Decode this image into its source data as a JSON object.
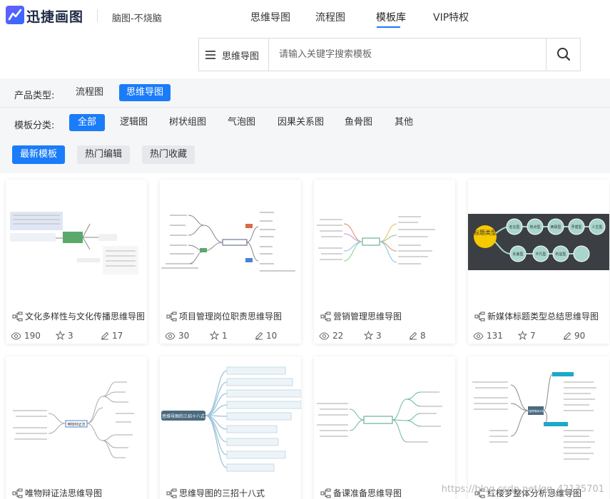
{
  "header": {
    "brand": "迅捷画图",
    "slogan": "脑图-不烧脑",
    "nav": [
      "思维导图",
      "流程图",
      "模板库",
      "VIP特权"
    ],
    "active_nav": "模板库"
  },
  "search": {
    "type_label": "思维导图",
    "placeholder": "请输入关键字搜索模板"
  },
  "filters": {
    "product_label": "产品类型:",
    "product_options": [
      "流程图",
      "思维导图"
    ],
    "product_selected": "思维导图",
    "category_label": "模板分类:",
    "category_options": [
      "全部",
      "逻辑图",
      "树状组图",
      "气泡图",
      "因果关系图",
      "鱼骨图",
      "其他"
    ],
    "category_selected": "全部",
    "sort_options": [
      "最新模板",
      "热门编辑",
      "热门收藏"
    ],
    "sort_selected": "最新模板"
  },
  "templates": [
    {
      "title": "文化多样性与文化传播思维导图",
      "views": "190",
      "stars": "3",
      "edits": "17"
    },
    {
      "title": "项目管理岗位职责思维导图",
      "views": "30",
      "stars": "1",
      "edits": "10"
    },
    {
      "title": "营销管理思维导图",
      "views": "22",
      "stars": "3",
      "edits": "8"
    },
    {
      "title": "新媒体标题类型总结思维导图",
      "views": "131",
      "stars": "7",
      "edits": "90"
    },
    {
      "title": "唯物辩证法思维导图",
      "views": "",
      "stars": "",
      "edits": ""
    },
    {
      "title": "思维导图的三招十八式",
      "views": "",
      "stars": "",
      "edits": ""
    },
    {
      "title": "备课准备思维导图",
      "views": "",
      "stars": "",
      "edits": ""
    },
    {
      "title": "红楼梦整体分析思维导图",
      "views": "",
      "stars": "",
      "edits": ""
    }
  ],
  "thumbnail_text": {
    "new_media_center": "标题类型",
    "new_media_nodes": [
      "名言型",
      "热点型",
      "两极型",
      "矛盾型",
      "人生型",
      "反差型",
      "平凡型",
      "利益型"
    ],
    "hub_5": "唯物辩证法",
    "hub_6": "思维导图的三招十八式",
    "hub_8": "红楼梦整体分析"
  },
  "watermark": "https://blog.csdn.net/qq_42135701",
  "colors": {
    "accent": "#1a7cf8",
    "filter_bg": "#f5f6f8",
    "new_media_bg": "#3b3f44",
    "new_media_center": "#f6c900",
    "new_media_node": "#a9d6cc"
  }
}
